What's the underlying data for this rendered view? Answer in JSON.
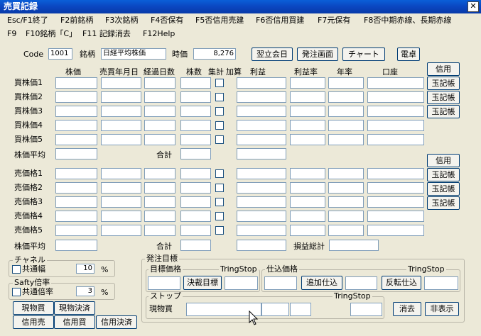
{
  "window": {
    "title": "売買記録",
    "close": "✕"
  },
  "menu": {
    "row1": [
      "Esc/F1終了",
      "F2前銘柄",
      "F3次銘柄",
      "F4否保有",
      "F5否信用売建",
      "F6否信用買建",
      "F7元保有",
      "F8否中期赤線、長期赤線"
    ],
    "row2": [
      "F9",
      "F10銘柄「C」",
      "F11 記録消去",
      "F12Help"
    ]
  },
  "top": {
    "code_label": "Code",
    "code_value": "1001",
    "meigara_label": "銘柄",
    "meigara_value": "日経平均株価",
    "jika_label": "時価",
    "jika_value": "8,276",
    "buttons": [
      "翌立会日",
      "発注画面",
      "チャート",
      "電卓"
    ]
  },
  "headers": [
    "株価",
    "売買年月日",
    "経過日数",
    "株数",
    "集計",
    "加算",
    "利益",
    "利益率",
    "年率",
    "口座"
  ],
  "buy_rows": [
    "買株価1",
    "買株価2",
    "買株価3",
    "買株価4",
    "買株価5"
  ],
  "buy_avg": "株価平均",
  "sell_rows": [
    "売価格1",
    "売価格2",
    "売価格3",
    "売価格4",
    "売価格5"
  ],
  "sell_avg": "株価平均",
  "total_label": "合計",
  "loss_total_label": "損益総計",
  "side_buttons": {
    "credit": "信用",
    "ledger": "玉記帳"
  },
  "channel": {
    "title": "チャネル",
    "check_label": "共通幅",
    "value": "10",
    "unit": "%"
  },
  "safety": {
    "title": "Safty倍率",
    "check_label": "共通倍率",
    "value": "3",
    "unit": "%"
  },
  "bottom_buttons": {
    "genbutsu_kai": "現物買",
    "genbutsu_kessai": "現物決済",
    "shinyo_uri": "信用売",
    "shinyo_kai": "信用買",
    "shinyo_kessai": "信用決済"
  },
  "order": {
    "title": "発注目標",
    "target_price": "目標価格",
    "tring1": "TringStop",
    "kessai_btn": "決裁目標",
    "shiire": "仕込価格",
    "tsuika_btn": "追加仕込",
    "tring2": "TringStop",
    "hanten_btn": "反転仕込",
    "stop_title": "ストップ",
    "tring3": "TringStop",
    "genbutsu_label": "現物買",
    "clear_btn": "消去",
    "hide_btn": "非表示"
  }
}
